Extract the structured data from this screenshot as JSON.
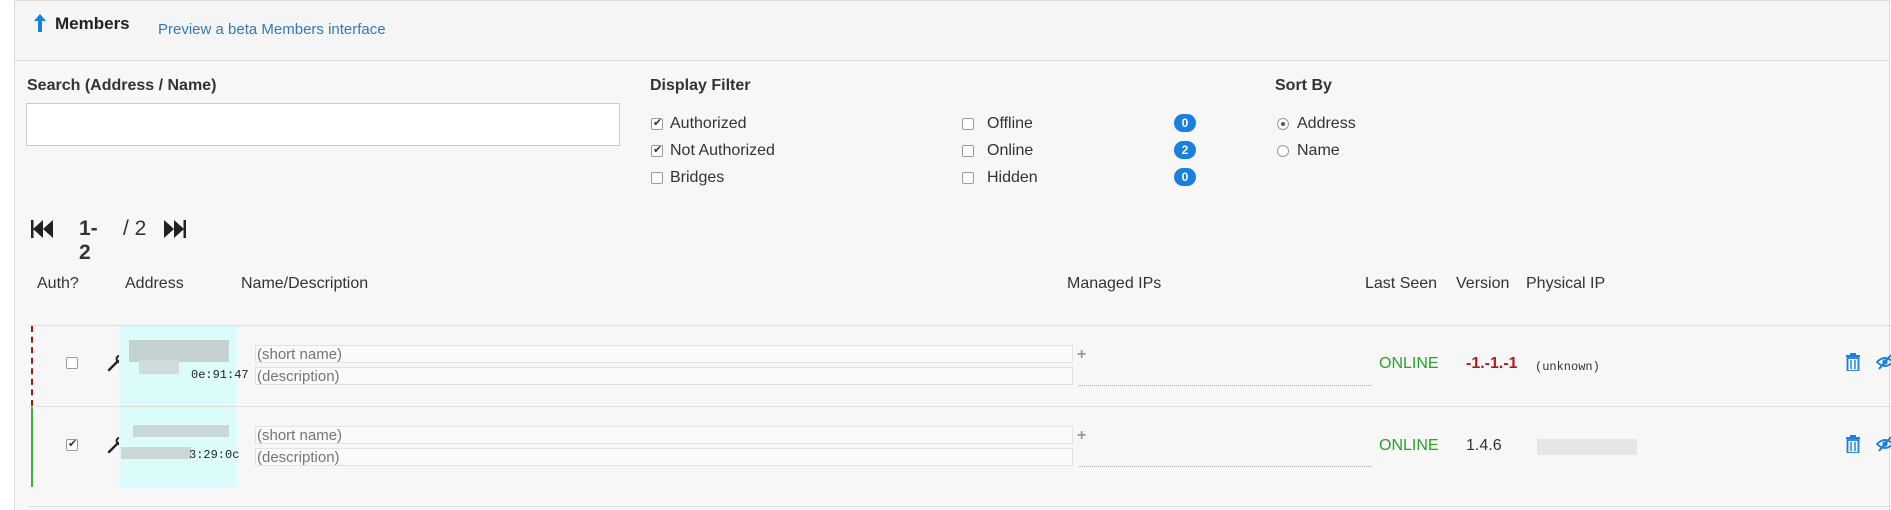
{
  "header": {
    "title": "Members",
    "beta_link": "Preview a beta Members interface"
  },
  "search": {
    "label": "Search (Address / Name)",
    "value": "",
    "placeholder": ""
  },
  "display_filter": {
    "label": "Display Filter",
    "options_left": [
      {
        "label": "Authorized",
        "checked": true
      },
      {
        "label": "Not Authorized",
        "checked": true
      },
      {
        "label": "Bridges",
        "checked": false
      }
    ],
    "options_right": [
      {
        "label": "Offline",
        "checked": false,
        "count": "0"
      },
      {
        "label": "Online",
        "checked": false,
        "count": "2"
      },
      {
        "label": "Hidden",
        "checked": false,
        "count": "0"
      }
    ]
  },
  "sort_by": {
    "label": "Sort By",
    "options": [
      {
        "label": "Address",
        "selected": true
      },
      {
        "label": "Name",
        "selected": false
      }
    ]
  },
  "pager": {
    "range": "1-2",
    "total": "/ 2"
  },
  "table": {
    "headers": {
      "auth": "Auth?",
      "address": "Address",
      "name": "Name/Description",
      "managed_ips": "Managed IPs",
      "last_seen": "Last Seen",
      "version": "Version",
      "physical_ip": "Physical IP"
    },
    "rows": [
      {
        "authorized": false,
        "address_suffix": "0e:91:47",
        "name_placeholder": "(short name)",
        "description_placeholder": "(description)",
        "last_seen": "ONLINE",
        "version": "-1.-1.-1",
        "physical_ip": "(unknown)"
      },
      {
        "authorized": true,
        "address_suffix": "3:29:0c",
        "name_placeholder": "(short name)",
        "description_placeholder": "(description)",
        "last_seen": "ONLINE",
        "version": "1.4.6",
        "physical_ip": ""
      }
    ]
  },
  "icons": {
    "header": "arrow-up-icon",
    "pager_prev": "fast-backward-icon",
    "pager_next": "fast-forward-icon",
    "edit": "wrench-icon",
    "add_ip": "plus-icon",
    "delete": "trash-icon",
    "hide": "eye-slash-icon"
  },
  "colors": {
    "link": "#337ab7",
    "badge": "#1a7fe0",
    "online": "#27a327",
    "version_bad": "#b31b1b",
    "address_bg": "#dcfcfc",
    "unauth_border": "#a31515",
    "auth_border": "#3fb33f"
  }
}
